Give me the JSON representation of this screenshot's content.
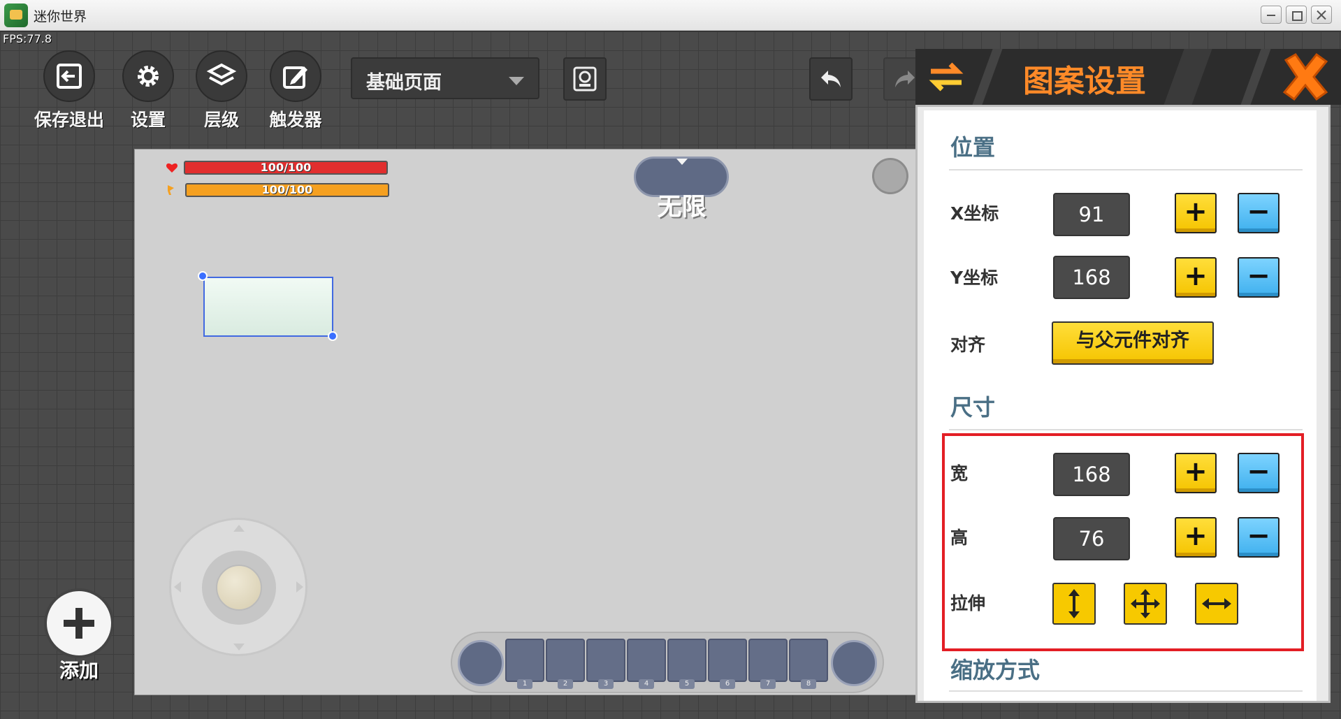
{
  "window": {
    "title": "迷你世界"
  },
  "fps": "FPS:77.8",
  "toolbar": {
    "save_exit": "保存退出",
    "settings": "设置",
    "layers": "层级",
    "triggers": "触发器",
    "page_select": "基础页面"
  },
  "hud": {
    "hp": "100/100",
    "hunger": "100/100",
    "mode": "无限"
  },
  "hotbar": {
    "slots": [
      "1",
      "2",
      "3",
      "4",
      "5",
      "6",
      "7",
      "8"
    ]
  },
  "add_label": "添加",
  "panel": {
    "title": "图案设置",
    "position_title": "位置",
    "x_label": "X坐标",
    "x_value": "91",
    "y_label": "Y坐标",
    "y_value": "168",
    "align_label": "对齐",
    "align_button": "与父元件对齐",
    "size_title": "尺寸",
    "width_label": "宽",
    "width_value": "168",
    "height_label": "高",
    "height_value": "76",
    "stretch_label": "拉伸",
    "scale_title": "缩放方式",
    "plus": "+",
    "minus": "−"
  },
  "colors": {
    "panel_title": "#ff8a28",
    "highlight": "#e31e25",
    "plus_button": "#f5c400",
    "minus_button": "#3fb0ee"
  }
}
